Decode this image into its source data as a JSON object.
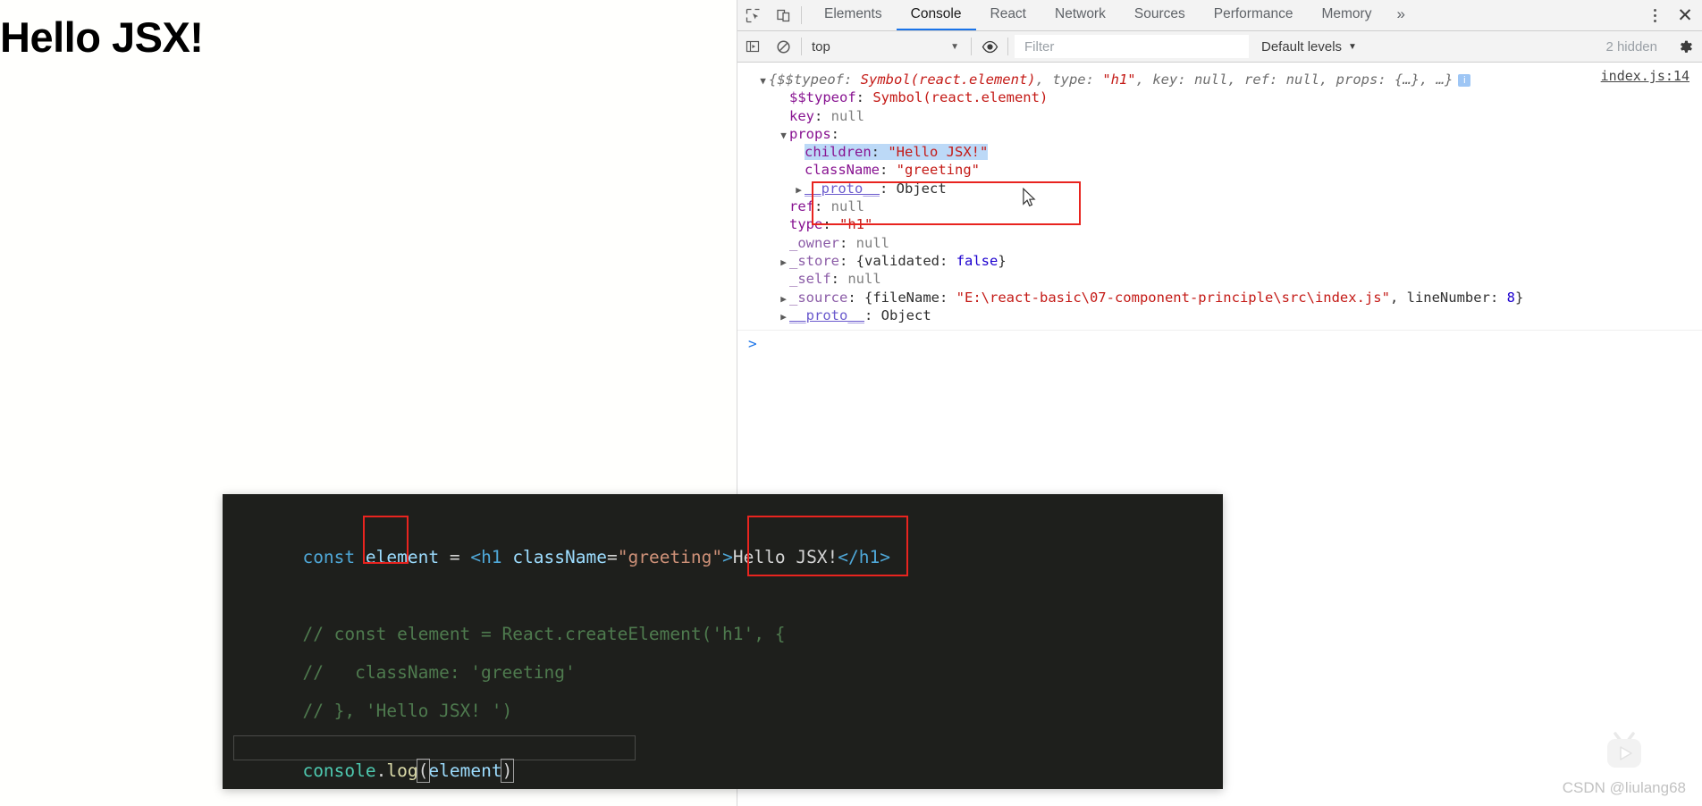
{
  "page": {
    "heading": "Hello JSX!"
  },
  "devtools": {
    "toolbar": {
      "inspect_icon": "inspect-element-icon",
      "device_icon": "device-toolbar-icon",
      "tabs": [
        {
          "label": "Elements",
          "active": false
        },
        {
          "label": "Console",
          "active": true
        },
        {
          "label": "React",
          "active": false
        },
        {
          "label": "Network",
          "active": false
        },
        {
          "label": "Sources",
          "active": false
        },
        {
          "label": "Performance",
          "active": false
        },
        {
          "label": "Memory",
          "active": false
        }
      ],
      "more_tabs_label": "»",
      "kebab_icon": "more-options-icon",
      "close_label": "✕"
    },
    "filterbar": {
      "sidebar_toggle_icon": "console-sidebar-icon",
      "clear_icon": "clear-console-icon",
      "context": "top",
      "context_caret": "▼",
      "eye_icon": "live-expression-icon",
      "filter_placeholder": "Filter",
      "filter_value": "",
      "levels": "Default levels",
      "levels_caret": "▼",
      "hidden_count": "2 hidden",
      "settings_icon": "settings-gear-icon"
    },
    "console": {
      "source_link": "index.js:14",
      "prompt": ">",
      "preview": {
        "open": "{",
        "entries": [
          {
            "key": "$$typeof",
            "value": "Symbol(react.element)",
            "kind": "sym"
          },
          {
            "key": "type",
            "value": "\"h1\"",
            "kind": "str"
          },
          {
            "key": "key",
            "value": "null",
            "kind": "null"
          },
          {
            "key": "ref",
            "value": "null",
            "kind": "null"
          },
          {
            "key": "props",
            "value": "{…}",
            "kind": "obj"
          }
        ],
        "ellipsis": "…",
        "close": "}",
        "badge": "i"
      },
      "rows": [
        {
          "indent": 1,
          "arrow": "blank",
          "key": "$$typeof",
          "sep": ": ",
          "value": "Symbol(react.element)",
          "kind": "sym"
        },
        {
          "indent": 1,
          "arrow": "blank",
          "key": "key",
          "sep": ": ",
          "value": "null",
          "kind": "null"
        },
        {
          "indent": 1,
          "arrow": "down",
          "key": "props",
          "sep": ":",
          "value": "",
          "kind": "none"
        },
        {
          "indent": 2,
          "arrow": "blank",
          "key": "children",
          "sep": ": ",
          "value": "\"Hello JSX!\"",
          "kind": "str",
          "selected": true
        },
        {
          "indent": 2,
          "arrow": "blank",
          "key": "className",
          "sep": ": ",
          "value": "\"greeting\"",
          "kind": "str"
        },
        {
          "indent": 2,
          "arrow": "right",
          "key": "__proto__",
          "sep": ": ",
          "value": "Object",
          "kind": "obj",
          "protokey": true
        },
        {
          "indent": 1,
          "arrow": "blank",
          "key": "ref",
          "sep": ": ",
          "value": "null",
          "kind": "null"
        },
        {
          "indent": 1,
          "arrow": "blank",
          "key": "type",
          "sep": ": ",
          "value": "\"h1\"",
          "kind": "str"
        },
        {
          "indent": 1,
          "arrow": "blank",
          "key": "_owner",
          "sep": ": ",
          "value": "null",
          "kind": "null",
          "ownkey": true
        },
        {
          "indent": 1,
          "arrow": "right",
          "key": "_store",
          "sep": ": ",
          "value": "{validated: false}",
          "kind": "store",
          "ownkey": true
        },
        {
          "indent": 1,
          "arrow": "blank",
          "key": "_self",
          "sep": ": ",
          "value": "null",
          "kind": "null",
          "ownkey": true
        },
        {
          "indent": 1,
          "arrow": "right",
          "key": "_source",
          "sep": ": ",
          "value": "{fileName: \"E:\\react-basic\\07-component-principle\\src\\index.js\", lineNumber: 8}",
          "kind": "source",
          "ownkey": true
        },
        {
          "indent": 1,
          "arrow": "right",
          "key": "__proto__",
          "sep": ": ",
          "value": "Object",
          "kind": "obj",
          "protokey": true
        }
      ],
      "store_detail": {
        "key": "validated",
        "value": "false"
      },
      "source_detail": {
        "filename_key": "fileName",
        "filename_value": "\"E:\\react-basic\\07-component-principle\\src\\index.js\"",
        "line_key": "lineNumber",
        "line_value": "8"
      }
    }
  },
  "code_panel": {
    "lines": [
      {
        "id": "line1",
        "tokens": [
          {
            "t": "const",
            "c": "c-kw"
          },
          {
            "t": " ",
            "c": "c-op"
          },
          {
            "t": "element",
            "c": "c-var"
          },
          {
            "t": " = ",
            "c": "c-op"
          },
          {
            "t": "<h1",
            "c": "c-tag"
          },
          {
            "t": " ",
            "c": "c-op"
          },
          {
            "t": "className",
            "c": "c-attr"
          },
          {
            "t": "=",
            "c": "c-op"
          },
          {
            "t": "\"greeting\"",
            "c": "c-str"
          },
          {
            "t": ">",
            "c": "c-tag"
          },
          {
            "t": "Hello JSX!",
            "c": "c-text"
          },
          {
            "t": "</h1>",
            "c": "c-tag"
          }
        ]
      },
      {
        "id": "line2",
        "tokens": [
          {
            "t": "// const element = React.createElement('h1', {",
            "c": "c-comment"
          }
        ]
      },
      {
        "id": "line3",
        "tokens": [
          {
            "t": "//   className: 'greeting'",
            "c": "c-comment"
          }
        ]
      },
      {
        "id": "line4",
        "tokens": [
          {
            "t": "// }, 'Hello JSX! ')",
            "c": "c-comment"
          }
        ]
      },
      {
        "id": "line5",
        "tokens": [
          {
            "t": "console",
            "c": "c-obj"
          },
          {
            "t": ".",
            "c": "c-punct"
          },
          {
            "t": "log",
            "c": "c-prop"
          },
          {
            "t": "(",
            "c": "c-bracket"
          },
          {
            "t": "element",
            "c": "c-var"
          },
          {
            "t": ")",
            "c": "c-bracket"
          }
        ]
      }
    ]
  },
  "watermark": {
    "text": "CSDN @liulang68",
    "logo_icon": "csdn-play-logo-icon"
  },
  "colors": {
    "accent": "#1a73e8",
    "annotation_red": "#e8241f",
    "code_bg": "#1e1f1c",
    "selection": "#bcd9f7"
  }
}
